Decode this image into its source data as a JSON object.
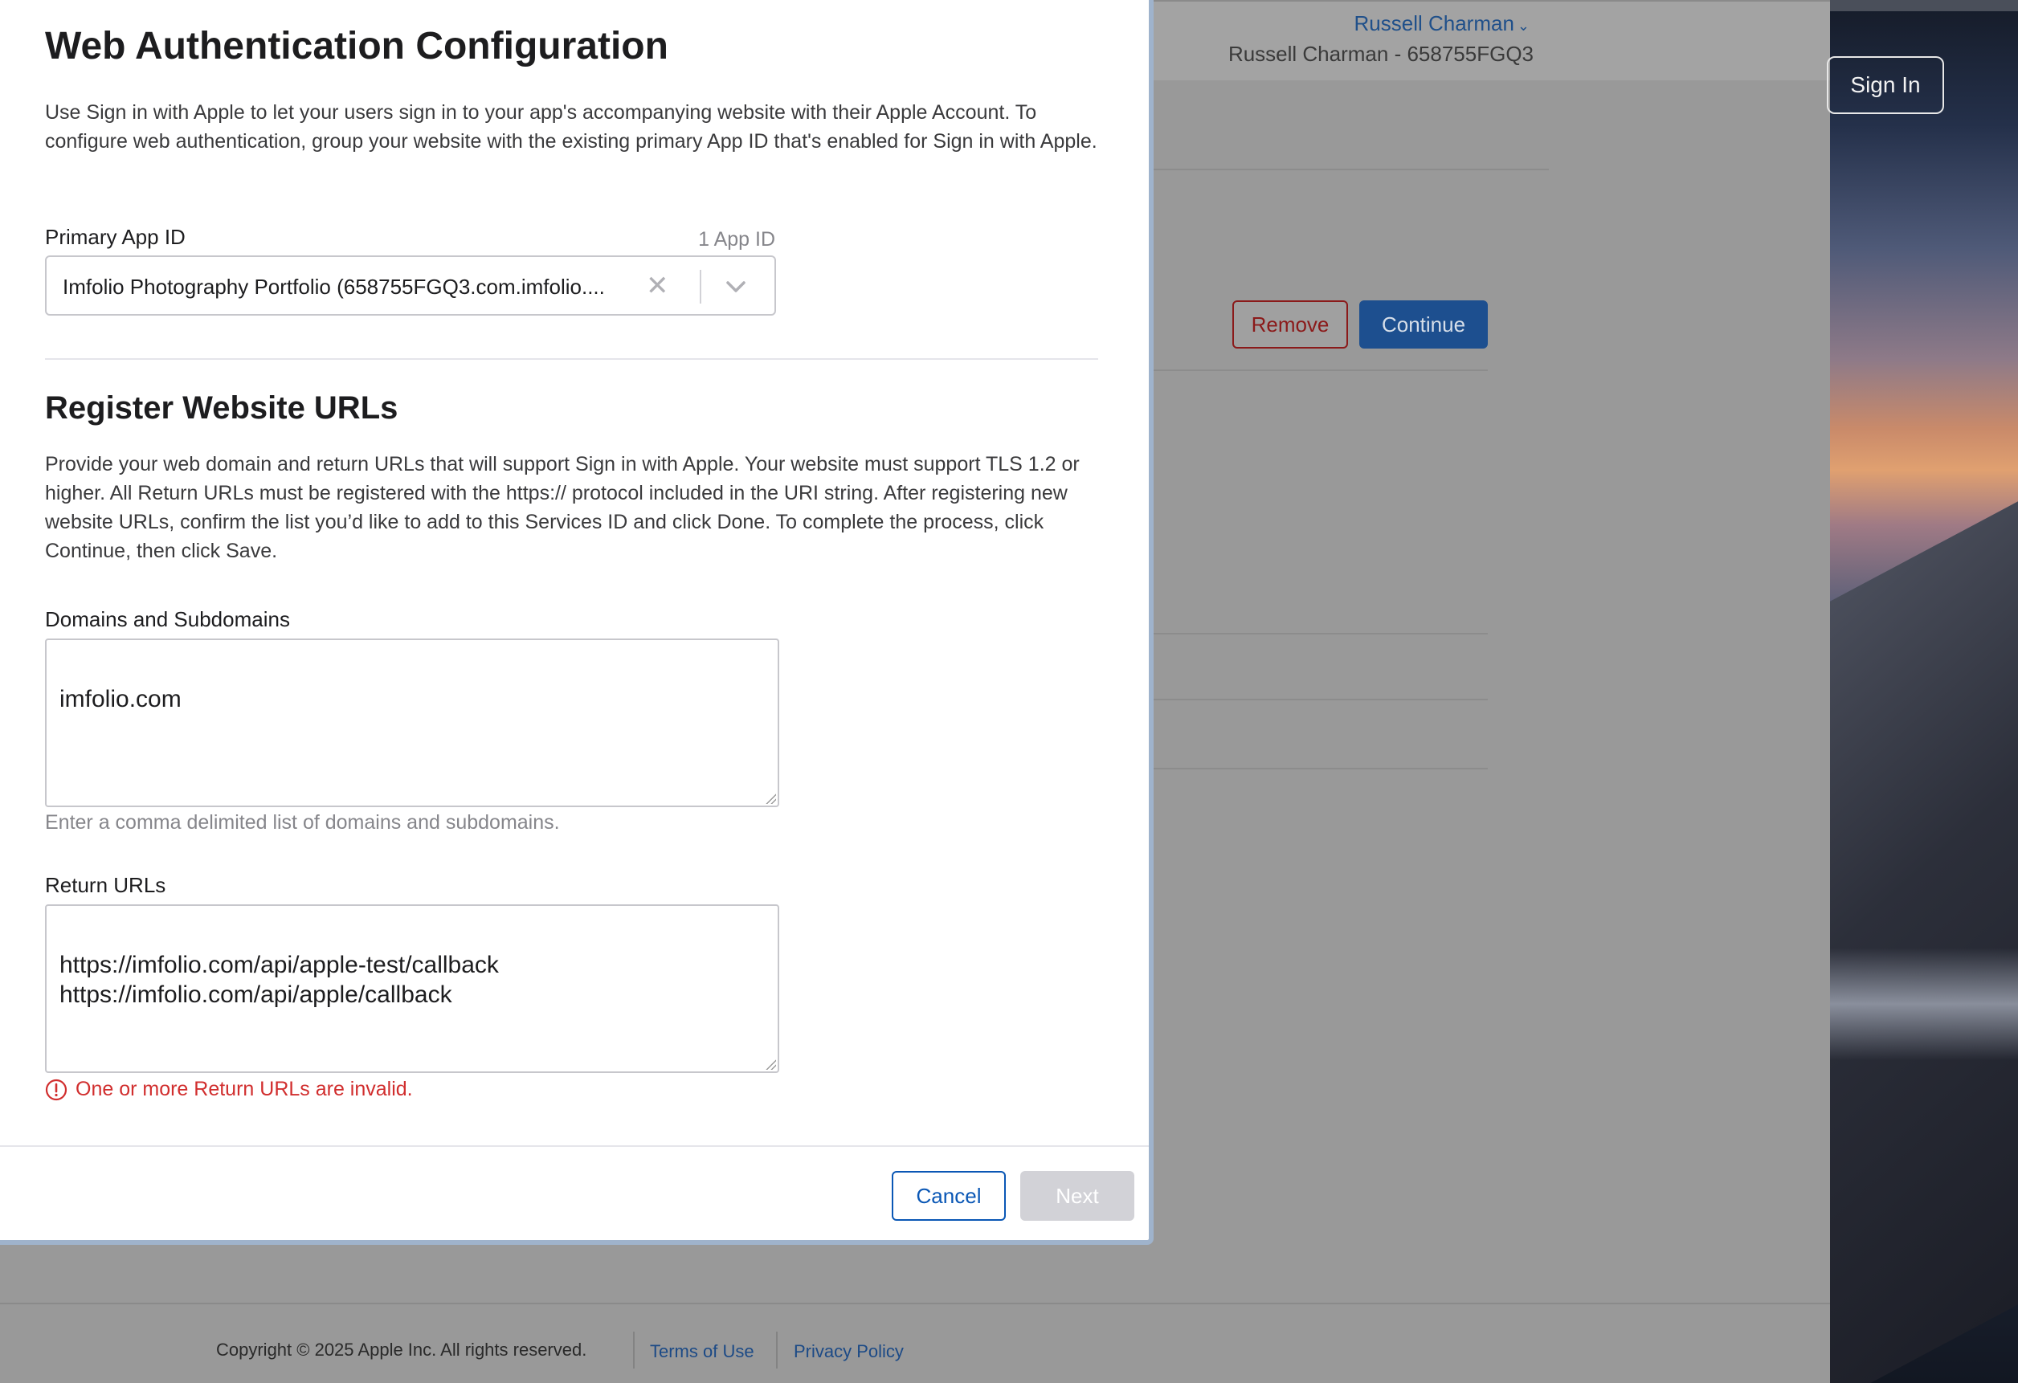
{
  "background": {
    "user_menu": "Russell Charman",
    "team_name": "Russell Charman - 658755FGQ3",
    "remove_label": "Remove",
    "continue_label": "Continue",
    "sign_in_label": "Sign In",
    "footer": {
      "copyright": "Copyright © 2025 Apple Inc. All rights reserved.",
      "terms": "Terms of Use",
      "privacy": "Privacy Policy"
    }
  },
  "modal": {
    "title": "Web Authentication Configuration",
    "intro": "Use Sign in with Apple to let your users sign in to your app's accompanying website with their Apple Account. To configure web authentication, group your website with the existing primary App ID that's enabled for Sign in with Apple.",
    "primary_app_id": {
      "label": "Primary App ID",
      "count": "1 App ID",
      "value": "Imfolio Photography Portfolio (658755FGQ3.com.imfolio...."
    },
    "register": {
      "title": "Register Website URLs",
      "description": "Provide your web domain and return URLs that will support Sign in with Apple. Your website must support TLS 1.2 or higher. All Return URLs must be registered with the https:// protocol included in the URI string. After registering new website URLs, confirm the list you’d like to add to this Services ID and click Done. To complete the process, click Continue, then click Save."
    },
    "domains": {
      "label": "Domains and Subdomains",
      "value": "imfolio.com",
      "hint": "Enter a comma delimited list of domains and subdomains."
    },
    "return_urls": {
      "label": "Return URLs",
      "value": "https://imfolio.com/api/apple-test/callback\nhttps://imfolio.com/api/apple/callback",
      "error": "One or more Return URLs are invalid."
    },
    "cancel_label": "Cancel",
    "next_label": "Next"
  },
  "colors": {
    "accent": "#0a57b5",
    "error": "#d12e2e",
    "disabled": "#d2d2d7"
  },
  "icons": [
    "clear-icon",
    "chevron-down-icon",
    "error-icon",
    "resize-grip-icon"
  ]
}
